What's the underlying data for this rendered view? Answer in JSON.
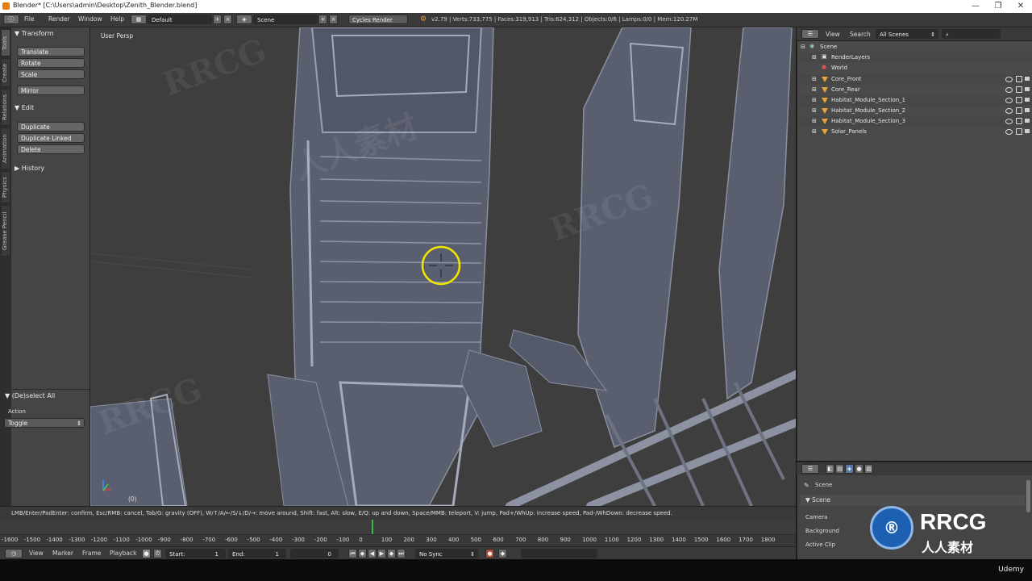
{
  "window": {
    "title": "Blender* [C:\\Users\\admin\\Desktop\\Zenith_Blender.blend]",
    "minimize": "—",
    "maximize": "❐",
    "close": "✕"
  },
  "infobar": {
    "menus": [
      "File",
      "Render",
      "Window",
      "Help"
    ],
    "layout": "Default",
    "scene": "Scene",
    "engine": "Cycles Render",
    "stats": "v2.79 | Verts:733,775 | Faces:319,913 | Tris:624,312 | Objects:0/6 | Lamps:0/0 | Mem:120.27M"
  },
  "tool_tabs": [
    "Tools",
    "Create",
    "Relations",
    "Animation",
    "Physics",
    "Grease Pencil"
  ],
  "toolshelf": {
    "transform_header": "Transform",
    "transform_buttons": [
      "Translate",
      "Rotate",
      "Scale"
    ],
    "mirror": "Mirror",
    "edit_header": "Edit",
    "edit_buttons": [
      "Duplicate",
      "Duplicate Linked",
      "Delete"
    ],
    "history_header": "History",
    "operator_header": "(De)select All",
    "action_label": "Action",
    "action_value": "Toggle"
  },
  "viewport": {
    "view_label": "User Persp",
    "frame_label": "(0)"
  },
  "statusline": "LMB/Enter/PadEnter: confirm, Esc/RMB: cancel, Tab/G: gravity (OFF), W/↑/A/←/S/↓/D/→: move around, Shift: fast, Alt: slow, E/Q: up and down, Space/MMB: teleport, V: jump, Pad+/WhUp: increase speed, Pad-/WhDown: decrease speed.",
  "outliner": {
    "view_menu": "View",
    "search_menu": "Search",
    "display_mode": "All Scenes",
    "rows": [
      {
        "label": "Scene",
        "indent": 0,
        "kind": "scene"
      },
      {
        "label": "RenderLayers",
        "indent": 1,
        "kind": "layers"
      },
      {
        "label": "World",
        "indent": 1,
        "kind": "world"
      },
      {
        "label": "Core_Front",
        "indent": 1,
        "kind": "object"
      },
      {
        "label": "Core_Rear",
        "indent": 1,
        "kind": "object"
      },
      {
        "label": "Habitat_Module_Section_1",
        "indent": 1,
        "kind": "object"
      },
      {
        "label": "Habitat_Module_Section_2",
        "indent": 1,
        "kind": "object"
      },
      {
        "label": "Habitat_Module_Section_3",
        "indent": 1,
        "kind": "object"
      },
      {
        "label": "Solar_Panels",
        "indent": 1,
        "kind": "object"
      }
    ]
  },
  "properties": {
    "section": "Scene",
    "panel": "Scene",
    "fields": [
      "Camera",
      "Background",
      "Active Clip"
    ]
  },
  "timeline": {
    "ticks": [
      "-1600",
      "-1500",
      "-1400",
      "-1300",
      "-1200",
      "-1100",
      "-1000",
      "-900",
      "-800",
      "-700",
      "-600",
      "-500",
      "-400",
      "-300",
      "-200",
      "-100",
      "0",
      "100",
      "200",
      "300",
      "400",
      "500",
      "600",
      "700",
      "800",
      "900",
      "1000",
      "1100",
      "1200",
      "1300",
      "1400",
      "1500",
      "1600",
      "1700",
      "1800"
    ],
    "menus": [
      "View",
      "Marker",
      "Frame",
      "Playback"
    ],
    "start_label": "Start:",
    "start_value": "1",
    "end_label": "End:",
    "end_value": "1",
    "current_frame": "0",
    "sync": "No Sync"
  },
  "watermarks": [
    "RRCG",
    "人人素材"
  ],
  "branding": {
    "logo_big": "RRCG",
    "logo_small": "人人素材",
    "udemy": "Udemy"
  },
  "colors": {
    "accent": "#e87d0d",
    "cursor": "#f2e600",
    "object_icon": "#e8a23a",
    "mesh": "#5d6273"
  }
}
